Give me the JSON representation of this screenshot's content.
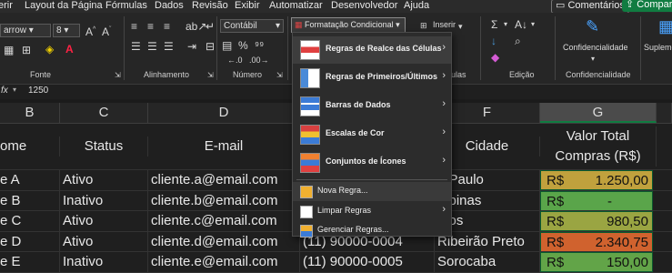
{
  "menubar": {
    "items": [
      "erir",
      "Layout da Página",
      "Fórmulas",
      "Dados",
      "Revisão",
      "Exibir",
      "Automatizar",
      "Desenvolvedor",
      "Ajuda"
    ],
    "comments": "Comentários",
    "share": "Compart"
  },
  "ribbon": {
    "font_name": "arrow",
    "font_size": "8",
    "number_format": "Contábil",
    "cond_format": "Formatação Condicional",
    "insert": "Inserir",
    "sensitivity": "Confidencialidade",
    "supplement": "Suplemen",
    "groups": {
      "font": "Fonte",
      "alignment": "Alinhamento",
      "number": "Número",
      "cells": "ulas",
      "editing": "Edição",
      "sensitivity": "Confidencialidade"
    }
  },
  "formula_bar": {
    "fx": "fx",
    "value": "1250"
  },
  "sheet": {
    "columns": [
      "B",
      "C",
      "D",
      "F",
      "G"
    ],
    "headers": {
      "name": "ome",
      "status": "Status",
      "email": "E-mail",
      "city": "Cidade",
      "total_line1": "Valor Total",
      "total_line2": "Compras (R$)"
    },
    "rows": [
      {
        "name": "e A",
        "status": "Ativo",
        "email": "cliente.a@email.com",
        "phone": "",
        "city": "o Paulo",
        "currency": "R$",
        "value": "1.250,00",
        "color": "#c0a13d"
      },
      {
        "name": "e B",
        "status": "Inativo",
        "email": "cliente.b@email.com",
        "phone": "",
        "city": "mpinas",
        "currency": "R$",
        "value": "-",
        "color": "#5aa54a"
      },
      {
        "name": "e C",
        "status": "Ativo",
        "email": "cliente.c@email.com",
        "phone": "",
        "city": "ntos",
        "currency": "R$",
        "value": "980,50",
        "color": "#9aa542"
      },
      {
        "name": "e D",
        "status": "Ativo",
        "email": "cliente.d@email.com",
        "phone": "(11) 90000-0004",
        "city": "Ribeirão Preto",
        "currency": "R$",
        "value": "2.340,75",
        "color": "#d0622e"
      },
      {
        "name": "e E",
        "status": "Inativo",
        "email": "cliente.e@email.com",
        "phone": "(11) 90000-0005",
        "city": "Sorocaba",
        "currency": "R$",
        "value": "150,00",
        "color": "#62a448"
      }
    ]
  },
  "dropdown": {
    "big_items": [
      "Regras de Realce das Células",
      "Regras de Primeiros/Últimos",
      "Barras de Dados",
      "Escalas de Cor",
      "Conjuntos de Ícones"
    ],
    "small_items": [
      "Nova Regra...",
      "Limpar Regras",
      "Gerenciar Regras..."
    ]
  },
  "colors": {
    "accent_green": "#107c41",
    "menu_bg": "#2c2c2c",
    "hover": "#3d3d3d"
  }
}
